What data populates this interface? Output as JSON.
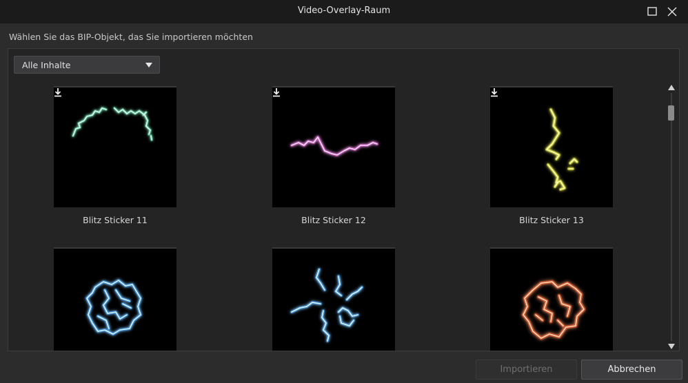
{
  "window": {
    "title": "Video-Overlay-Raum",
    "maximize_icon": "maximize-icon",
    "close_icon": "close-icon"
  },
  "instruction": "Wählen Sie das BIP-Objekt, das Sie importieren möchten",
  "filter": {
    "selected": "Alle Inhalte",
    "icon": "chevron-down-icon"
  },
  "items": [
    {
      "label": "Blitz Sticker 11",
      "color": "#9ff5d6",
      "glow": "#4fe0a8",
      "icon": "download-icon"
    },
    {
      "label": "Blitz Sticker 12",
      "color": "#ff9cf2",
      "glow": "#e040d0",
      "icon": "download-icon"
    },
    {
      "label": "Blitz Sticker 13",
      "color": "#fbff6a",
      "glow": "#d8e000",
      "icon": "download-icon"
    },
    {
      "label": "",
      "color": "#8fe4ff",
      "glow": "#1fa8ff"
    },
    {
      "label": "",
      "color": "#9fe8ff",
      "glow": "#2aa6ff"
    },
    {
      "label": "",
      "color": "#ffb072",
      "glow": "#ff5a10"
    }
  ],
  "buttons": {
    "import": "Importieren",
    "cancel": "Abbrechen"
  }
}
